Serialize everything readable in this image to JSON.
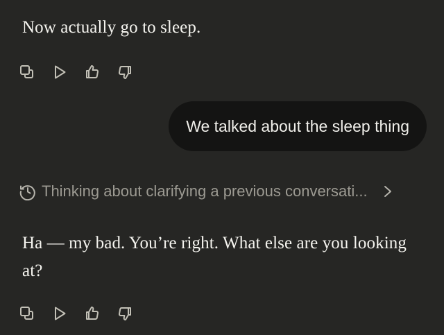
{
  "conversation": {
    "assistant_message_1": "Now actually go to sleep.",
    "user_message": "We talked about the sleep thing",
    "thinking_summary": "Thinking about clarifying a previous conversati...",
    "assistant_message_2": "Ha — my bad. You’re right. What else are you looking at?"
  },
  "actions": {
    "icons": [
      "copy-icon",
      "play-icon",
      "thumbs-up-icon",
      "thumbs-down-icon"
    ]
  },
  "thinking": {
    "icons": [
      "clock-icon",
      "chevron-right-icon"
    ]
  },
  "colors": {
    "background": "#262624",
    "user_bubble": "#141413",
    "assistant_text": "#f5f4ef",
    "muted_text": "#9c9a92"
  }
}
